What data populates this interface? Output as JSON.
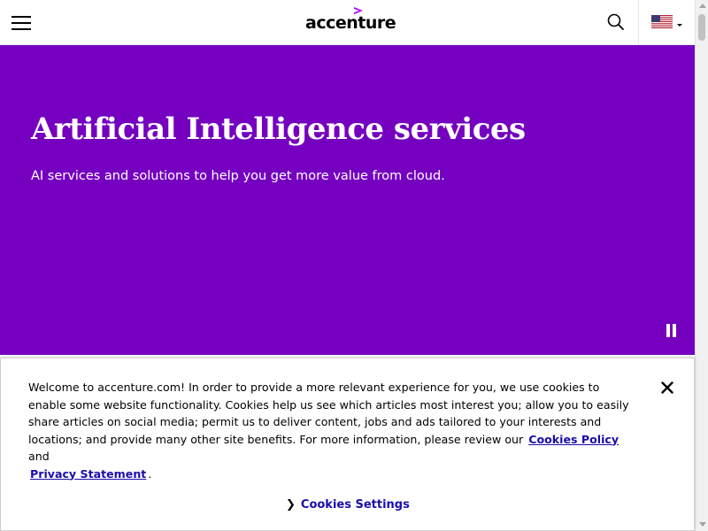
{
  "header": {
    "logo_text": "accenture",
    "menu_icon": "hamburger-menu-icon",
    "search_icon": "search-icon",
    "country_flag": "us-flag-icon"
  },
  "hero": {
    "title": "Artificial Intelligence services",
    "subtitle": "AI services and solutions to help you get more value from cloud.",
    "background_color": "#7500c0",
    "pause_icon": "pause-icon"
  },
  "cookie_banner": {
    "text_before": "Welcome to accenture.com! In order to provide a more relevant experience for you, we use cookies to enable some website functionality. Cookies help us see which articles most interest you; allow you to easily share articles on social media; permit us to deliver content, jobs and ads tailored to your interests and locations; and provide many other site benefits. For more information, please review our",
    "cookies_policy_link": "Cookies Policy",
    "and_text": "and",
    "privacy_statement_link": "Privacy Statement",
    "period": ".",
    "settings_button": "Cookies Settings",
    "close_icon": "close-icon",
    "link_color": "#1a0dab"
  }
}
